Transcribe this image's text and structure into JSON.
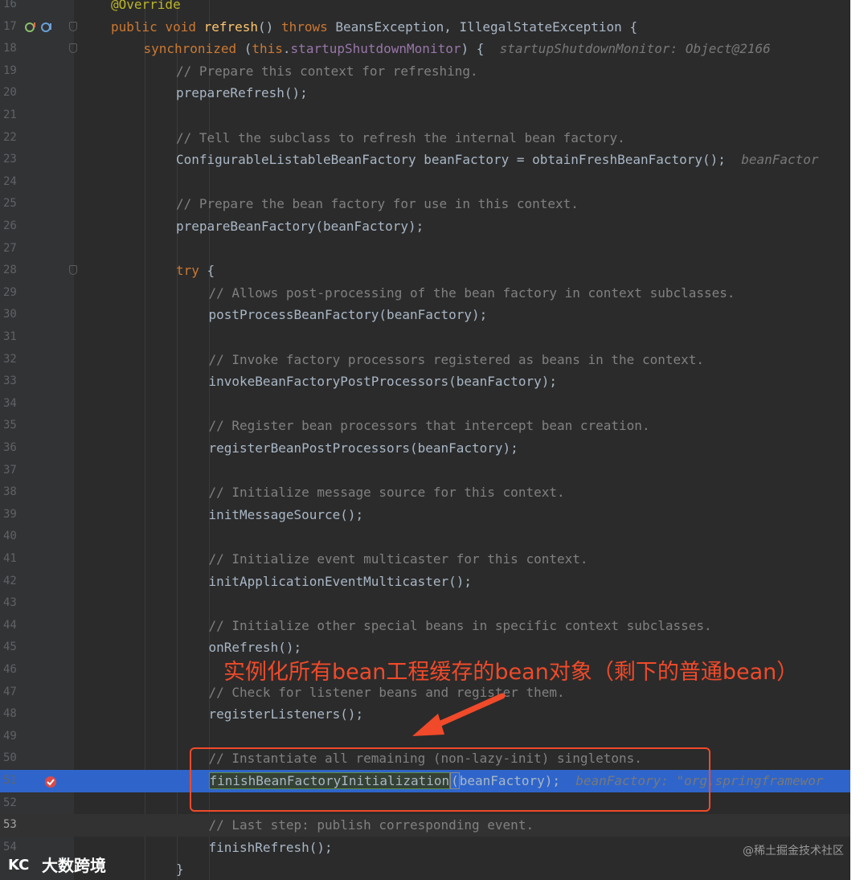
{
  "editor": {
    "colors": {
      "background": "#2b2b2b",
      "gutter": "#313335",
      "keyword": "#cc7832",
      "method": "#ffc66d",
      "comment": "#808080",
      "field": "#9876aa",
      "current_line": "#2f65ca",
      "annotation_red": "#f04a2a"
    },
    "lines": [
      {
        "num": "16",
        "indent": 1,
        "parts": [
          {
            "t": "@Override",
            "c": "ann"
          }
        ]
      },
      {
        "num": "17",
        "indent": 1,
        "gutter_icons": [
          "override-icon",
          "implemented-icon"
        ],
        "fold": true,
        "parts": [
          {
            "t": "public ",
            "c": "kw"
          },
          {
            "t": "void ",
            "c": "kw"
          },
          {
            "t": "refresh",
            "c": "fn"
          },
          {
            "t": "() ",
            "c": "plain"
          },
          {
            "t": "throws ",
            "c": "kw"
          },
          {
            "t": "BeansException, IllegalStateException {",
            "c": "plain"
          }
        ]
      },
      {
        "num": "18",
        "indent": 2,
        "fold": true,
        "parts": [
          {
            "t": "synchronized ",
            "c": "kw"
          },
          {
            "t": "(",
            "c": "plain"
          },
          {
            "t": "this",
            "c": "kw"
          },
          {
            "t": ".",
            "c": "plain"
          },
          {
            "t": "startupShutdownMonitor",
            "c": "field"
          },
          {
            "t": ") {  ",
            "c": "plain"
          },
          {
            "t": "startupShutdownMonitor: Object@2166",
            "c": "hint"
          }
        ]
      },
      {
        "num": "19",
        "indent": 3,
        "parts": [
          {
            "t": "// Prepare this context for refreshing.",
            "c": "comment"
          }
        ]
      },
      {
        "num": "20",
        "indent": 3,
        "parts": [
          {
            "t": "prepareRefresh();",
            "c": "plain"
          }
        ]
      },
      {
        "num": "21",
        "indent": 3,
        "parts": []
      },
      {
        "num": "22",
        "indent": 3,
        "parts": [
          {
            "t": "// Tell the subclass to refresh the internal bean factory.",
            "c": "comment"
          }
        ]
      },
      {
        "num": "23",
        "indent": 3,
        "parts": [
          {
            "t": "ConfigurableListableBeanFactory beanFactory = obtainFreshBeanFactory();  ",
            "c": "plain"
          },
          {
            "t": "beanFactor",
            "c": "hint"
          }
        ]
      },
      {
        "num": "24",
        "indent": 3,
        "parts": []
      },
      {
        "num": "25",
        "indent": 3,
        "parts": [
          {
            "t": "// Prepare the bean factory for use in this context.",
            "c": "comment"
          }
        ]
      },
      {
        "num": "26",
        "indent": 3,
        "parts": [
          {
            "t": "prepareBeanFactory(beanFactory);",
            "c": "plain"
          }
        ]
      },
      {
        "num": "27",
        "indent": 3,
        "parts": []
      },
      {
        "num": "28",
        "indent": 3,
        "fold": true,
        "parts": [
          {
            "t": "try ",
            "c": "kw"
          },
          {
            "t": "{",
            "c": "plain"
          }
        ]
      },
      {
        "num": "29",
        "indent": 4,
        "parts": [
          {
            "t": "// Allows post-processing of the bean factory in context subclasses.",
            "c": "comment"
          }
        ]
      },
      {
        "num": "30",
        "indent": 4,
        "parts": [
          {
            "t": "postProcessBeanFactory(beanFactory);",
            "c": "plain"
          }
        ]
      },
      {
        "num": "31",
        "indent": 4,
        "parts": []
      },
      {
        "num": "32",
        "indent": 4,
        "parts": [
          {
            "t": "// Invoke factory processors registered as beans in the context.",
            "c": "comment"
          }
        ]
      },
      {
        "num": "33",
        "indent": 4,
        "parts": [
          {
            "t": "invokeBeanFactoryPostProcessors(beanFactory);",
            "c": "plain"
          }
        ]
      },
      {
        "num": "34",
        "indent": 4,
        "parts": []
      },
      {
        "num": "35",
        "indent": 4,
        "parts": [
          {
            "t": "// Register bean processors that intercept bean creation.",
            "c": "comment"
          }
        ]
      },
      {
        "num": "36",
        "indent": 4,
        "parts": [
          {
            "t": "registerBeanPostProcessors(beanFactory);",
            "c": "plain"
          }
        ]
      },
      {
        "num": "37",
        "indent": 4,
        "parts": []
      },
      {
        "num": "38",
        "indent": 4,
        "parts": [
          {
            "t": "// Initialize message source for this context.",
            "c": "comment"
          }
        ]
      },
      {
        "num": "39",
        "indent": 4,
        "parts": [
          {
            "t": "initMessageSource();",
            "c": "plain"
          }
        ]
      },
      {
        "num": "40",
        "indent": 4,
        "parts": []
      },
      {
        "num": "41",
        "indent": 4,
        "parts": [
          {
            "t": "// Initialize event multicaster for this context.",
            "c": "comment"
          }
        ]
      },
      {
        "num": "42",
        "indent": 4,
        "parts": [
          {
            "t": "initApplicationEventMulticaster();",
            "c": "plain"
          }
        ]
      },
      {
        "num": "43",
        "indent": 4,
        "parts": []
      },
      {
        "num": "44",
        "indent": 4,
        "parts": [
          {
            "t": "// Initialize other special beans in specific context subclasses.",
            "c": "comment"
          }
        ]
      },
      {
        "num": "45",
        "indent": 4,
        "parts": [
          {
            "t": "onRefresh();",
            "c": "plain"
          }
        ]
      },
      {
        "num": "46",
        "indent": 4,
        "parts": []
      },
      {
        "num": "47",
        "indent": 4,
        "parts": [
          {
            "t": "// Check for listener beans and register them.",
            "c": "comment"
          }
        ]
      },
      {
        "num": "48",
        "indent": 4,
        "parts": [
          {
            "t": "registerListeners();",
            "c": "plain"
          }
        ]
      },
      {
        "num": "49",
        "indent": 4,
        "parts": []
      },
      {
        "num": "50",
        "indent": 4,
        "parts": [
          {
            "t": "// Instantiate all remaining (non-lazy-init) singletons.",
            "c": "comment"
          }
        ]
      },
      {
        "num": "51",
        "indent": 4,
        "current": true,
        "breakpoint": true,
        "parts": [
          {
            "t": "finishBeanFactoryInitialization",
            "c": "selected-method"
          },
          {
            "t": "(",
            "c": "selected-paren"
          },
          {
            "t": "beanFactory);  ",
            "c": "plain"
          },
          {
            "t": "beanFactory: \"org.springframewor",
            "c": "hint"
          }
        ]
      },
      {
        "num": "52",
        "indent": 4,
        "parts": []
      },
      {
        "num": "53",
        "indent": 4,
        "caret_row": true,
        "parts": [
          {
            "t": "// Last step: publish corresponding event.",
            "c": "comment"
          }
        ]
      },
      {
        "num": "54",
        "indent": 4,
        "parts": [
          {
            "t": "finishRefresh();",
            "c": "plain"
          }
        ]
      },
      {
        "num": "",
        "indent": 3,
        "parts": [
          {
            "t": "}",
            "c": "plain"
          }
        ]
      }
    ]
  },
  "annotation": {
    "text": "实例化所有bean工程缓存的bean对象（剩下的普通bean）"
  },
  "brand": {
    "logo_icon": "kc-logo-icon",
    "name": "大数跨境"
  },
  "watermark": "@稀土掘金技术社区"
}
